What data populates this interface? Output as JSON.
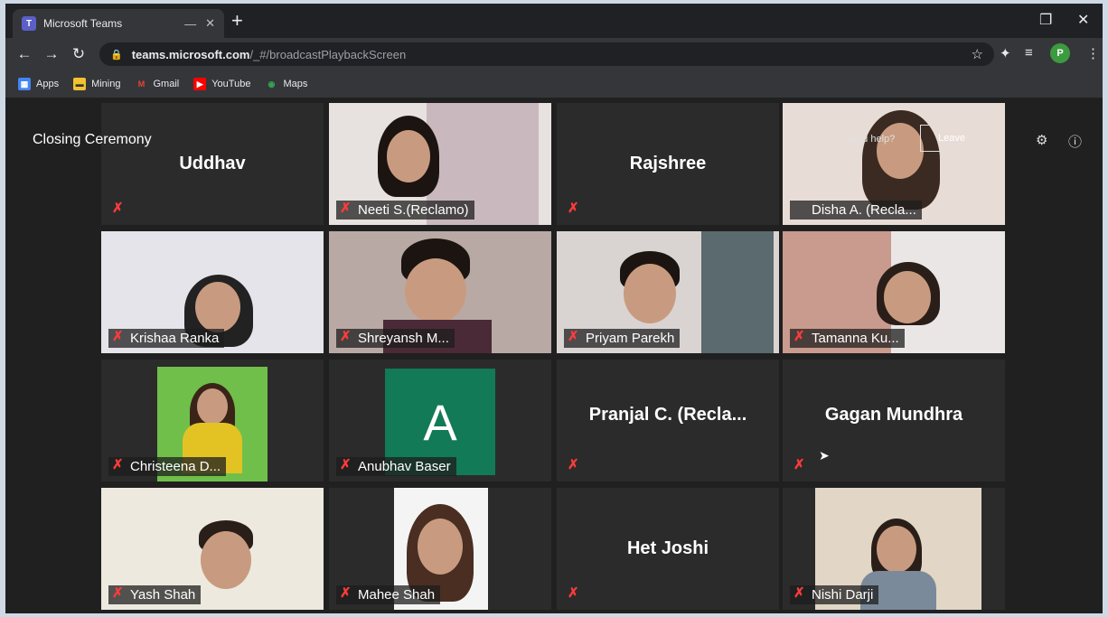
{
  "browser": {
    "tab_title": "Microsoft Teams",
    "tab_icon": "teams-icon",
    "url_host": "teams.microsoft.com",
    "url_path": "/_#/broadcastPlaybackScreen",
    "profile_initial": "P",
    "bookmarks": [
      {
        "label": "Apps",
        "icon": "apps-grid-icon"
      },
      {
        "label": "Mining",
        "icon": "folder-icon"
      },
      {
        "label": "Gmail",
        "icon": "gmail-icon"
      },
      {
        "label": "YouTube",
        "icon": "youtube-icon"
      },
      {
        "label": "Maps",
        "icon": "maps-icon"
      }
    ]
  },
  "meeting": {
    "title": "Closing Ceremony",
    "help_link": "Need help?",
    "leave_label": "Leave",
    "participants": [
      {
        "name": "Uddhav",
        "type": "name"
      },
      {
        "name": "Neeti S.(Reclamo)",
        "type": "video"
      },
      {
        "name": "Rajshree",
        "type": "name"
      },
      {
        "name": "Disha A. (Recla...",
        "type": "video",
        "active": true
      },
      {
        "name": "Krishaa Ranka",
        "type": "video"
      },
      {
        "name": "Shreyansh M...",
        "type": "video"
      },
      {
        "name": "Priyam Parekh",
        "type": "video"
      },
      {
        "name": "Tamanna Ku...",
        "type": "video"
      },
      {
        "name": "Christeena D...",
        "type": "video"
      },
      {
        "name": "Anubhav Baser",
        "type": "avatar",
        "initial": "A"
      },
      {
        "name": "Pranjal C. (Recla...",
        "type": "name"
      },
      {
        "name": "Gagan Mundhra",
        "type": "name"
      },
      {
        "name": "Yash Shah",
        "type": "video"
      },
      {
        "name": "Mahee Shah",
        "type": "video"
      },
      {
        "name": "Het Joshi",
        "type": "name"
      },
      {
        "name": "Nishi Darji",
        "type": "video"
      }
    ]
  },
  "colors": {
    "active_speaker_outline": "#d8d65a",
    "muted_mic": "#ff3b3b",
    "avatar_bg": "#127a56"
  }
}
